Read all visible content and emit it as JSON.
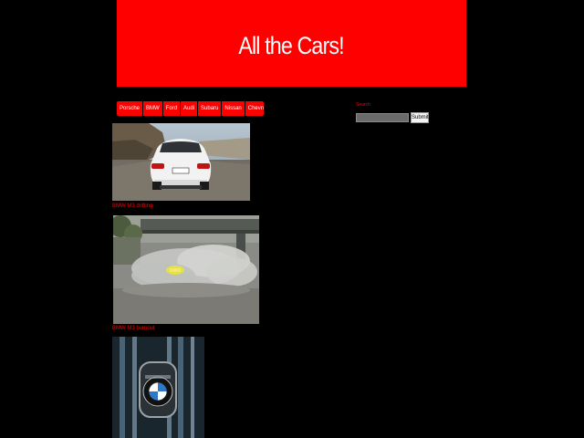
{
  "header": {
    "title": "All the Cars!"
  },
  "nav": {
    "items": [
      {
        "label": "Porsche"
      },
      {
        "label": "BMW"
      },
      {
        "label": "Ford"
      },
      {
        "label": "Audi"
      },
      {
        "label": "Subaru"
      },
      {
        "label": "Nissan"
      },
      {
        "label": "Chevrolet"
      }
    ]
  },
  "posts": [
    {
      "caption": "BMW M3 drifting",
      "image": "white-bmw-m3-rear-photo"
    },
    {
      "caption": "BMW M3 burnout",
      "image": "car-drifting-smoke-photo"
    },
    {
      "caption": "",
      "image": "bmw-logo-badge-photo"
    }
  ],
  "sidebar": {
    "search_label": "Search",
    "search_value": "",
    "search_button": "Submit"
  },
  "colors": {
    "background": "#000000",
    "accent": "#ff0000",
    "text_on_accent": "#ffffff"
  }
}
